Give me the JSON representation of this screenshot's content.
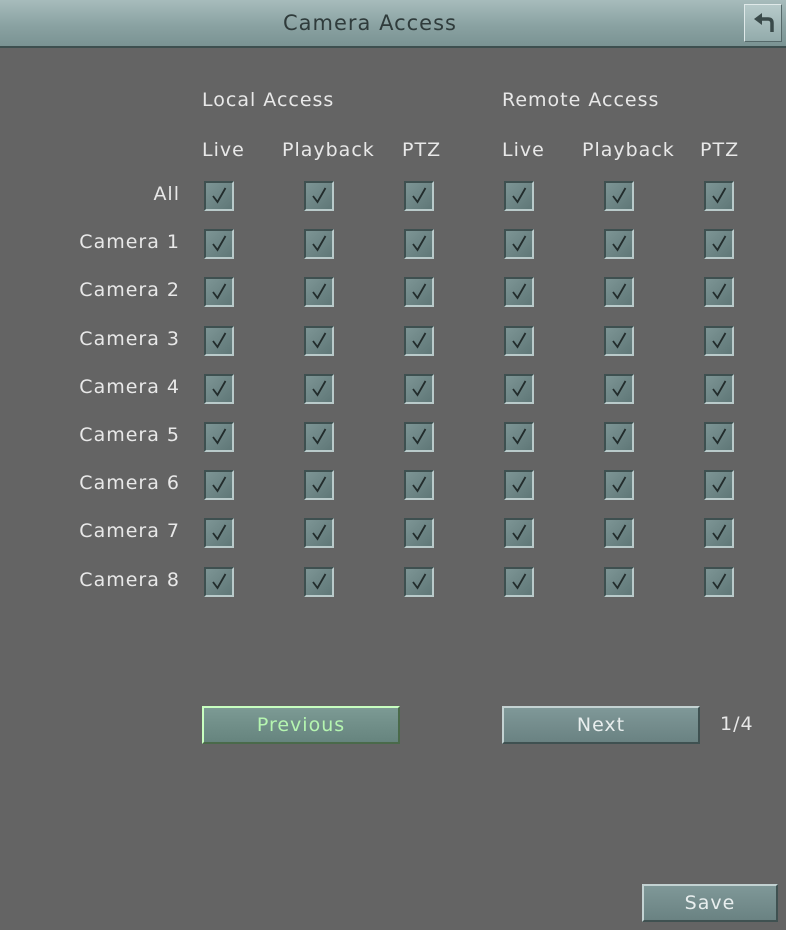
{
  "window": {
    "title": "Camera Access"
  },
  "groups": {
    "local": "Local  Access",
    "remote": "Remote  Access"
  },
  "columns": [
    "Live",
    "Playback",
    "PTZ",
    "Live",
    "Playback",
    "PTZ"
  ],
  "rows": [
    {
      "label": "All",
      "checked": [
        true,
        true,
        true,
        true,
        true,
        true
      ]
    },
    {
      "label": "Camera  1",
      "checked": [
        true,
        true,
        true,
        true,
        true,
        true
      ]
    },
    {
      "label": "Camera  2",
      "checked": [
        true,
        true,
        true,
        true,
        true,
        true
      ]
    },
    {
      "label": "Camera  3",
      "checked": [
        true,
        true,
        true,
        true,
        true,
        true
      ]
    },
    {
      "label": "Camera  4",
      "checked": [
        true,
        true,
        true,
        true,
        true,
        true
      ]
    },
    {
      "label": "Camera  5",
      "checked": [
        true,
        true,
        true,
        true,
        true,
        true
      ]
    },
    {
      "label": "Camera  6",
      "checked": [
        true,
        true,
        true,
        true,
        true,
        true
      ]
    },
    {
      "label": "Camera  7",
      "checked": [
        true,
        true,
        true,
        true,
        true,
        true
      ]
    },
    {
      "label": "Camera  8",
      "checked": [
        true,
        true,
        true,
        true,
        true,
        true
      ]
    }
  ],
  "pagination": {
    "previous": "Previous",
    "next": "Next",
    "page": "1/4"
  },
  "actions": {
    "save": "Save"
  },
  "icons": {
    "back": "back-arrow-icon",
    "check": "checkmark-icon"
  },
  "colors": {
    "background": "#646464",
    "titlebar": "#8aa2a2",
    "checkbox": "#6d8585",
    "previous_text": "#b5f5b0"
  }
}
